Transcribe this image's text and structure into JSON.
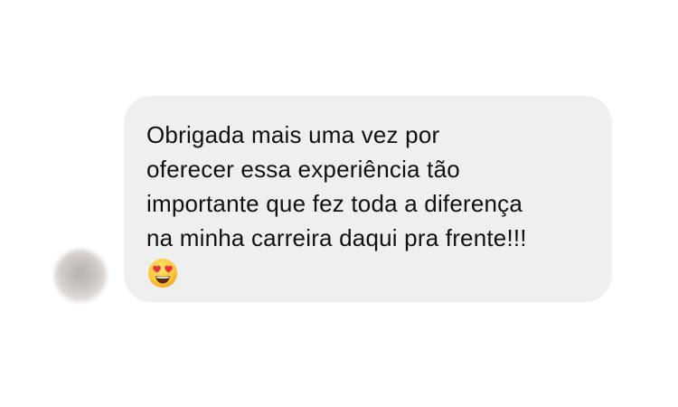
{
  "message": {
    "text": "Obrigada mais uma vez por\noferecer essa experiência tão\nimportante que fez toda a diferença\nna minha carreira daqui pra frente!!!",
    "emoji": "smiling-face-with-heart-eyes"
  },
  "colors": {
    "bubble_background": "#efefef",
    "text": "#111111",
    "page_background": "#ffffff"
  }
}
